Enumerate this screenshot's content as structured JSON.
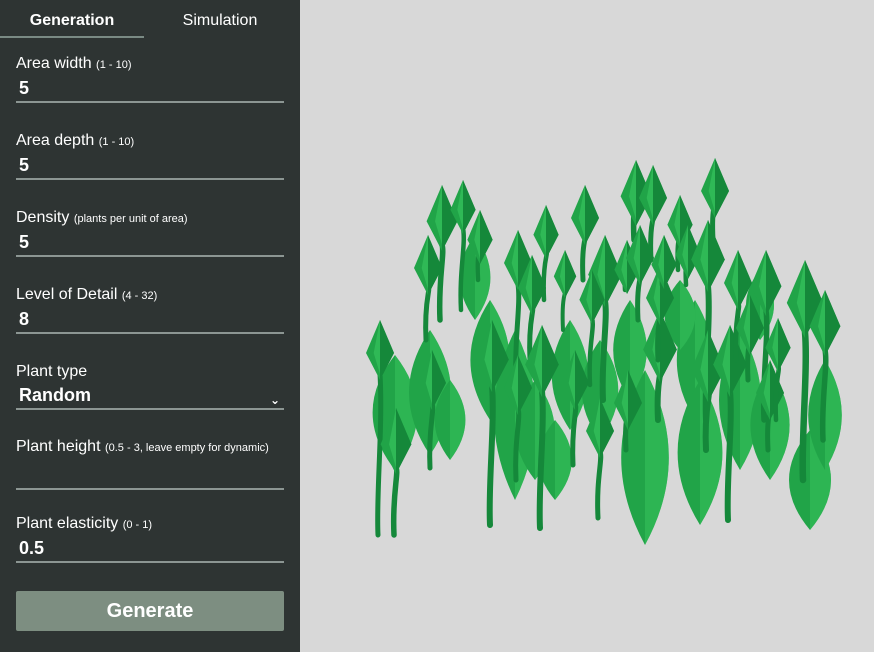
{
  "tabs": [
    {
      "label": "Generation",
      "active": true
    },
    {
      "label": "Simulation",
      "active": false
    }
  ],
  "fields": {
    "area_width": {
      "label": "Area width",
      "hint": "(1 - 10)",
      "value": "5"
    },
    "area_depth": {
      "label": "Area depth",
      "hint": "(1 - 10)",
      "value": "5"
    },
    "density": {
      "label": "Density",
      "hint": "(plants per unit of area)",
      "value": "5"
    },
    "level_of_detail": {
      "label": "Level of Detail",
      "hint": "(4 - 32)",
      "value": "8"
    },
    "plant_type": {
      "label": "Plant type",
      "selected": "Random"
    },
    "plant_height": {
      "label": "Plant height",
      "hint": "(0.5 - 3, leave empty for dynamic)",
      "value": ""
    },
    "plant_elasticity": {
      "label": "Plant elasticity",
      "hint": "(0 - 1)",
      "value": "0.5"
    }
  },
  "generate_label": "Generate",
  "colors": {
    "sidebar_bg": "#2e3433",
    "viewport_bg": "#d8d8d8",
    "button_bg": "#7d8e81",
    "plant_dark": "#15883a",
    "plant_mid": "#21a448",
    "plant_light": "#36c25c"
  }
}
